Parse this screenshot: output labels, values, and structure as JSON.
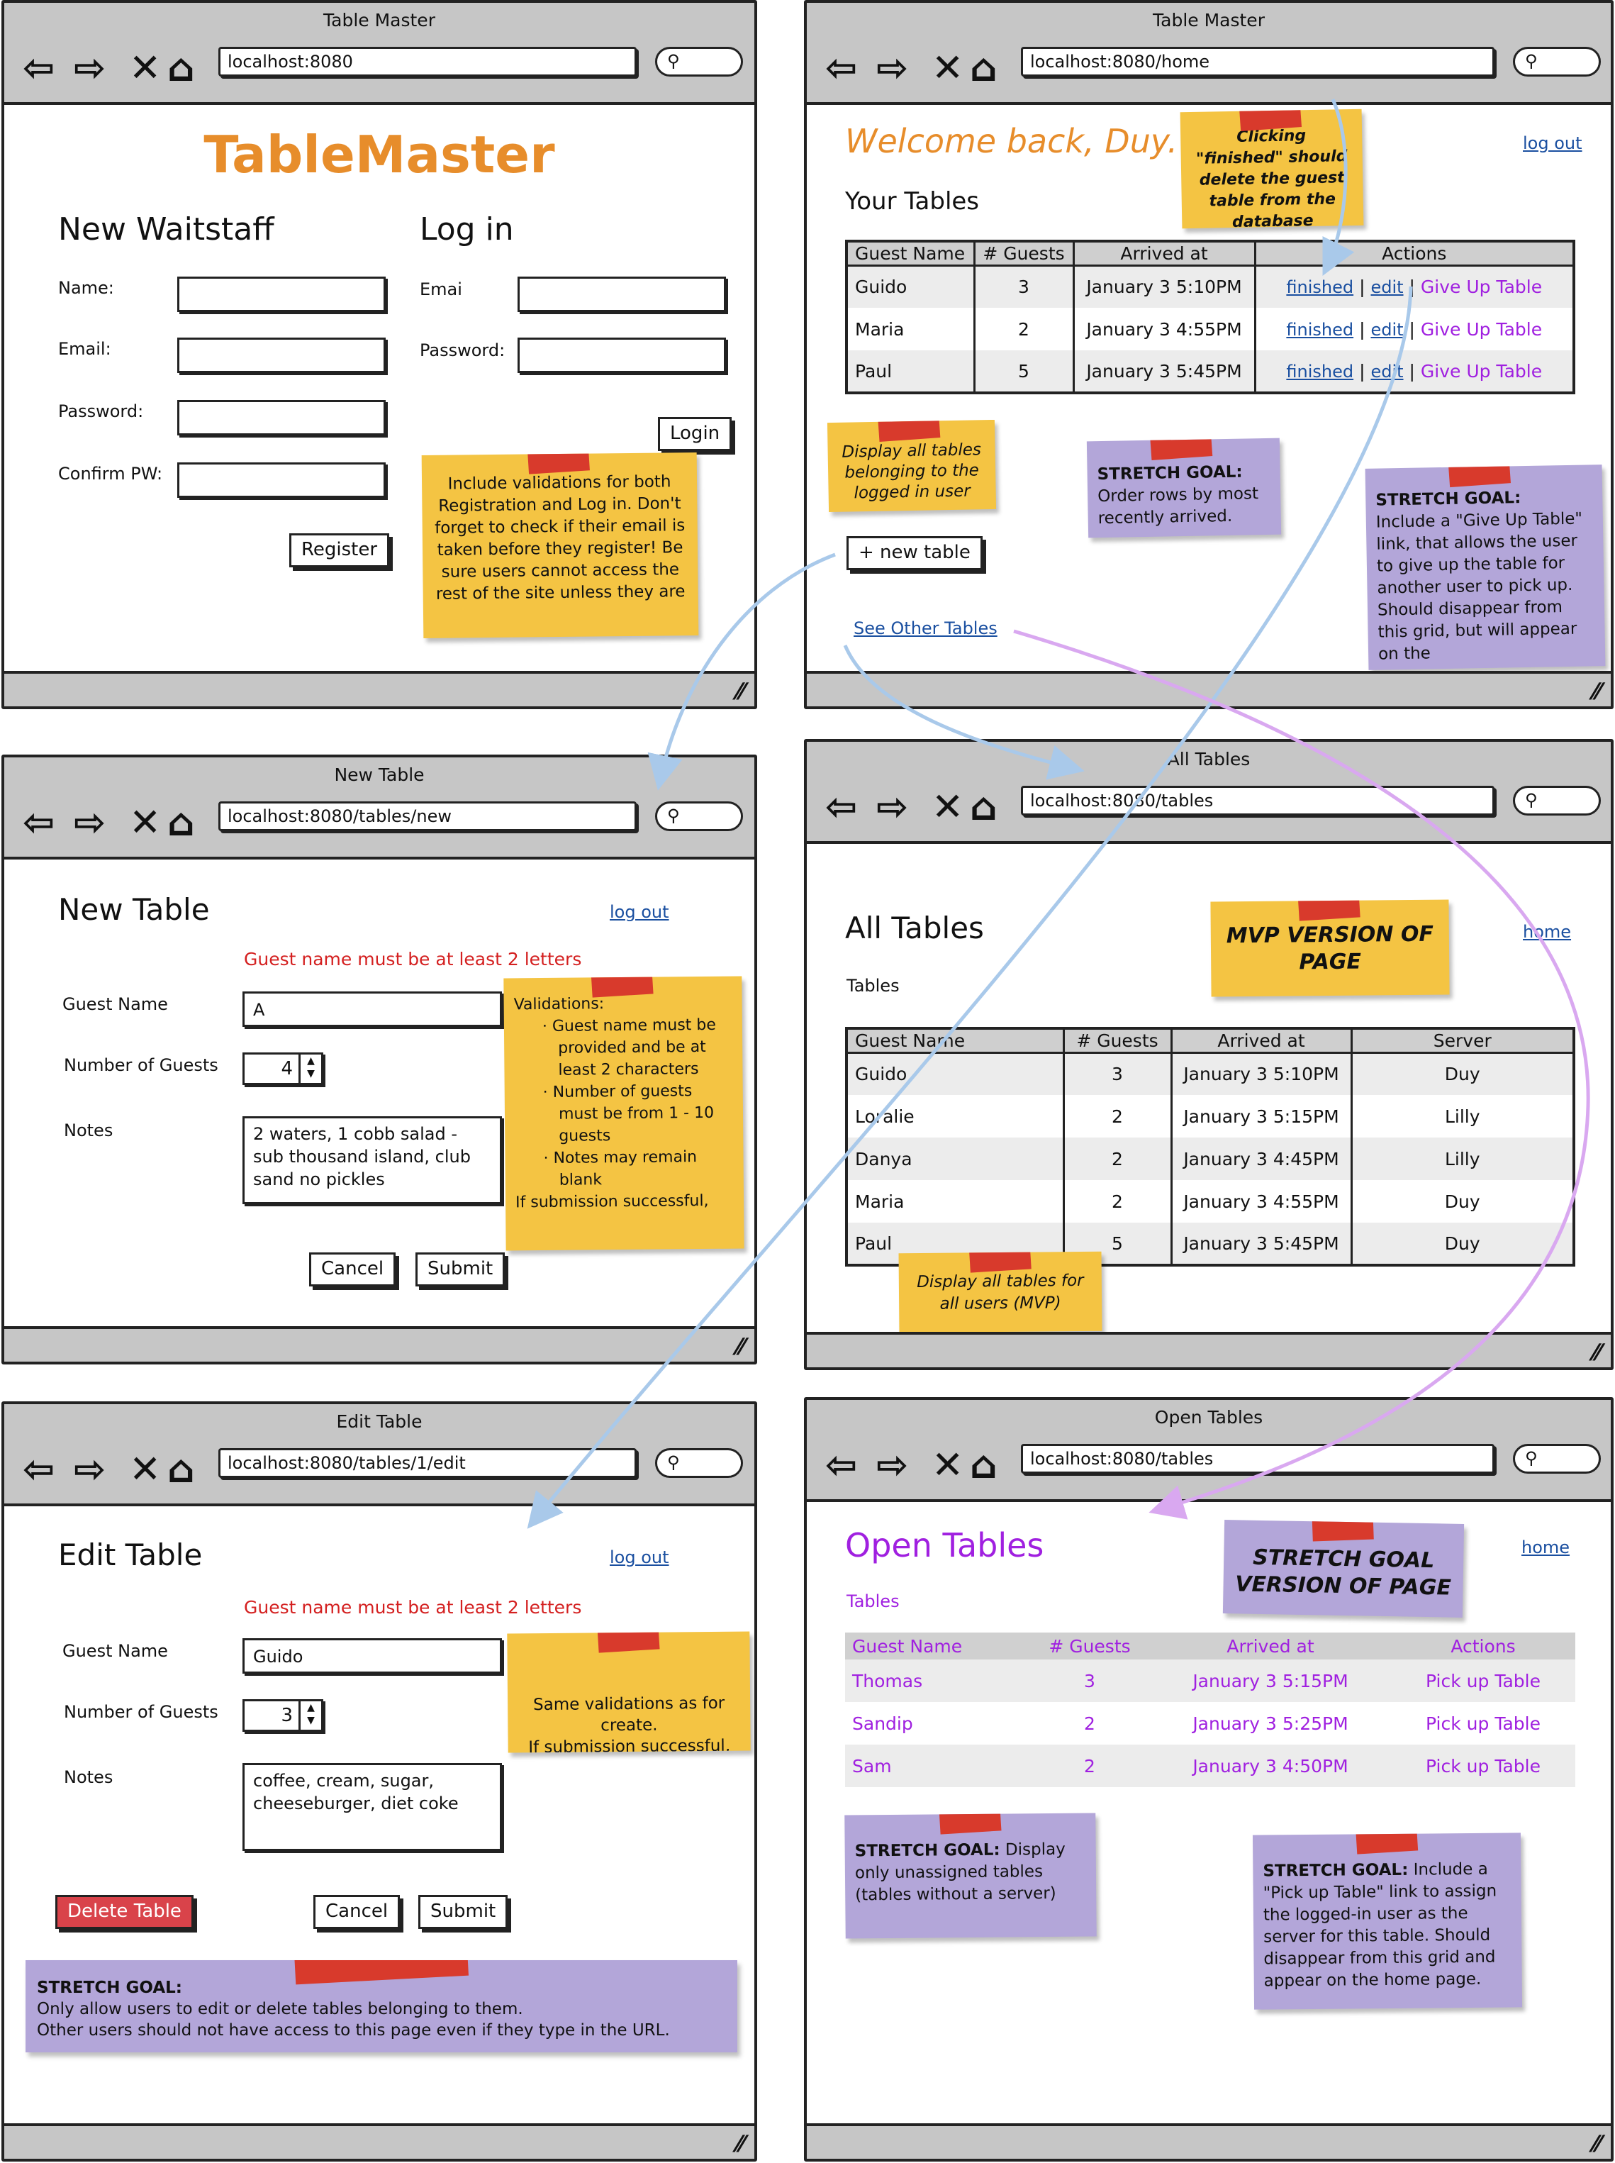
{
  "colors": {
    "accent_orange": "#e78d2b",
    "purple": "#a020e0",
    "link_blue": "#1a4fa0",
    "error_red": "#d42020",
    "sticky_yellow": "#f4c443",
    "sticky_purple": "#b3a6d9",
    "tape_red": "#d83a2c",
    "arrow_blue": "#a9c9ea",
    "arrow_purple": "#d9a8f0"
  },
  "icons": {
    "back": "back-arrow-icon",
    "forward": "forward-arrow-icon",
    "stop": "stop-x-icon",
    "home": "home-icon",
    "search": "search-icon",
    "resize": "resize-grip-icon"
  },
  "w1": {
    "title": "Table Master",
    "url": "localhost:8080",
    "brand": "TableMaster",
    "register_heading": "New Waitstaff",
    "name_label": "Name:",
    "email_label": "Email:",
    "password_label": "Password:",
    "confirm_label": "Confirm PW:",
    "register_button": "Register",
    "login_heading": "Log in",
    "login_email_label": "Emai",
    "login_password_label": "Password:",
    "login_button": "Login",
    "note": "Include validations for both Registration and Log in. Don't forget to check if their email is taken before they register! Be sure users cannot access the rest of the site unless they are"
  },
  "w2": {
    "title": "Table Master",
    "url": "localhost:8080/home",
    "welcome": "Welcome back, Duy.",
    "logout": "log out",
    "your_tables": "Your Tables",
    "headers": [
      "Guest Name",
      "# Guests",
      "Arrived at",
      "Actions"
    ],
    "rows": [
      {
        "name": "Guido",
        "guests": "3",
        "arrived": "January 3 5:10PM"
      },
      {
        "name": "Maria",
        "guests": "2",
        "arrived": "January 3 4:55PM"
      },
      {
        "name": "Paul",
        "guests": "5",
        "arrived": "January 3 5:45PM"
      }
    ],
    "action_finished": "finished",
    "action_sep": "|",
    "action_edit": "edit",
    "action_giveup": "Give Up Table",
    "new_table_button": "+ new table",
    "see_other": "See Other Tables",
    "note_finished": "Clicking \"finished\" should delete the guest table from the database",
    "note_display": "Display all tables belonging to the logged in user",
    "note_order_title": "STRETCH GOAL:",
    "note_order_text": "Order rows by most recently arrived.",
    "note_giveup_title": "STRETCH GOAL:",
    "note_giveup_text": "Include a \"Give Up Table\" link, that allows the user to give up the table for another user to pick up. Should disappear from this grid, but will appear on the"
  },
  "w3": {
    "title": "New Table",
    "url": "localhost:8080/tables/new",
    "heading": "New Table",
    "logout": "log out",
    "error": "Guest name must be at least 2 letters",
    "guest_label": "Guest Name",
    "guest_value": "A",
    "num_label": "Number of Guests",
    "num_value": "4",
    "notes_label": "Notes",
    "notes_value": "2 waters, 1 cobb salad - sub thousand island, club sand no pickles",
    "cancel": "Cancel",
    "submit": "Submit",
    "note_title": "Validations:",
    "note_items": [
      "Guest name must be provided and be at least 2 characters",
      "Number of guests must be from 1 - 10 guests",
      "Notes may remain blank"
    ],
    "note_footer": "If submission successful,"
  },
  "w4": {
    "title": "All Tables",
    "url": "localhost:8080/tables",
    "heading": "All Tables",
    "home": "home",
    "subheading": "Tables",
    "headers": [
      "Guest Name",
      "# Guests",
      "Arrived at",
      "Server"
    ],
    "rows": [
      {
        "name": "Guido",
        "guests": "3",
        "arrived": "January 3 5:10PM",
        "server": "Duy"
      },
      {
        "name": "Loralie",
        "guests": "2",
        "arrived": "January 3 5:15PM",
        "server": "Lilly"
      },
      {
        "name": "Danya",
        "guests": "2",
        "arrived": "January 3 4:45PM",
        "server": "Lilly"
      },
      {
        "name": "Maria",
        "guests": "2",
        "arrived": "January 3 4:55PM",
        "server": "Duy"
      },
      {
        "name": "Paul",
        "guests": "5",
        "arrived": "January 3 5:45PM",
        "server": "Duy"
      }
    ],
    "note_mvp": "MVP VERSION OF PAGE",
    "note_display": "Display all tables for all users (MVP)"
  },
  "w5": {
    "title": "Edit Table",
    "url": "localhost:8080/tables/1/edit",
    "heading": "Edit Table",
    "logout": "log out",
    "error": "Guest name must be at least 2 letters",
    "guest_label": "Guest Name",
    "guest_value": "Guido",
    "num_label": "Number of Guests",
    "num_value": "3",
    "notes_label": "Notes",
    "notes_value": "coffee, cream, sugar, cheeseburger, diet coke",
    "delete": "Delete Table",
    "cancel": "Cancel",
    "submit": "Submit",
    "note_validations": "Same validations as for create.\nIf submission successful, redirect to the dashboard.",
    "note_stretch_title": "STRETCH GOAL:",
    "note_stretch_line1": "Only allow users to edit or delete tables belonging to them.",
    "note_stretch_line2": "Other users should not have access to this page even if they type in the URL."
  },
  "w6": {
    "title": "Open Tables",
    "url": "localhost:8080/tables",
    "heading": "Open Tables",
    "home": "home",
    "subheading": "Tables",
    "headers": [
      "Guest Name",
      "# Guests",
      "Arrived at",
      "Actions"
    ],
    "rows": [
      {
        "name": "Thomas",
        "guests": "3",
        "arrived": "January 3 5:15PM",
        "action": "Pick up Table"
      },
      {
        "name": "Sandip",
        "guests": "2",
        "arrived": "January 3 5:25PM",
        "action": "Pick up Table"
      },
      {
        "name": "Sam",
        "guests": "2",
        "arrived": "January 3 4:50PM",
        "action": "Pick up Table"
      }
    ],
    "note_version": "STRETCH GOAL VERSION OF PAGE",
    "note_unassigned_title": "STRETCH GOAL:",
    "note_unassigned_text": " Display only unassigned tables (tables without a server)",
    "note_pickup_title": "STRETCH GOAL:",
    "note_pickup_text": " Include a \"Pick up Table\" link to assign the logged-in user as the server for this table. Should disappear from this grid and appear on the home page."
  }
}
